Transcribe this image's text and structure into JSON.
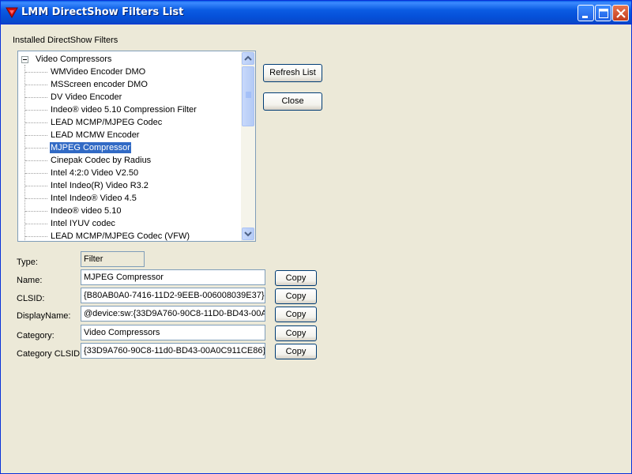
{
  "window": {
    "title": "LMM DirectShow Filters List",
    "accent_color": "#0A47C6"
  },
  "installed_label": "Installed DirectShow Filters",
  "tree": {
    "root_label": "Video Compressors",
    "items": [
      "WMVideo Encoder DMO",
      "MSScreen encoder DMO",
      "DV Video Encoder",
      "Indeo® video 5.10 Compression Filter",
      "LEAD MCMP/MJPEG Codec",
      "LEAD MCMW Encoder",
      "MJPEG Compressor",
      "Cinepak Codec by Radius",
      "Intel 4:2:0 Video V2.50",
      "Intel Indeo(R) Video R3.2",
      "Intel Indeo® Video 4.5",
      "Indeo® video 5.10",
      "Intel IYUV codec",
      "LEAD MCMP/MJPEG Codec (VFW)"
    ],
    "selected": "MJPEG Compressor"
  },
  "buttons": {
    "refresh": "Refresh List",
    "close": "Close",
    "copy": "Copy"
  },
  "details": {
    "type_label": "Type:",
    "type_value": "Filter",
    "name_label": "Name:",
    "name_value": "MJPEG Compressor",
    "clsid_label": "CLSID:",
    "clsid_value": "{B80AB0A0-7416-11D2-9EEB-006008039E37}",
    "displayname_label": "DisplayName:",
    "displayname_value": "@device:sw:{33D9A760-90C8-11D0-BD43-00A",
    "category_label": "Category:",
    "category_value": "Video Compressors",
    "category_clsid_label": "Category CLSID:",
    "category_clsid_value": "{33D9A760-90C8-11d0-BD43-00A0C911CE86}"
  }
}
